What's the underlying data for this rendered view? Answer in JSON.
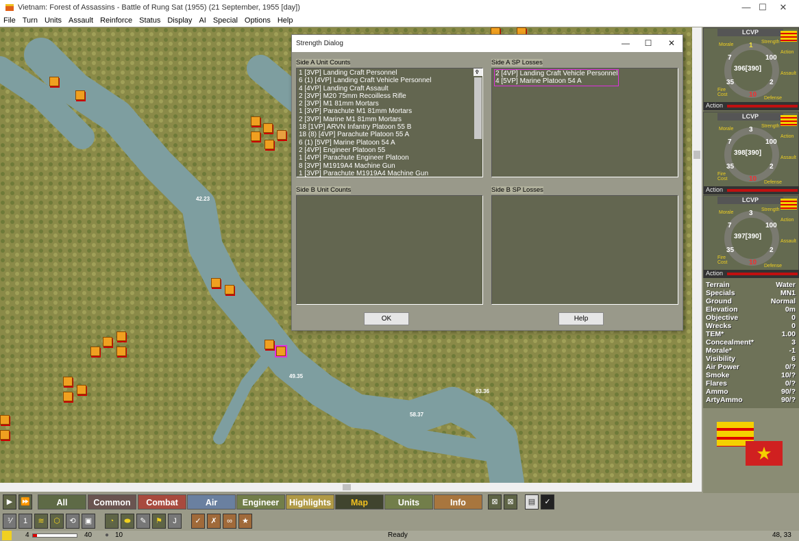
{
  "window": {
    "title": "Vietnam: Forest of Assassins - Battle of Rung Sat (1955) (21 September, 1955 [day])",
    "min": "—",
    "max": "☐",
    "close": "✕"
  },
  "menu": [
    "File",
    "Turn",
    "Units",
    "Assault",
    "Reinforce",
    "Status",
    "Display",
    "AI",
    "Special",
    "Options",
    "Help"
  ],
  "map": {
    "labels": [
      "42.23",
      "49.35",
      "58.37",
      "63.36"
    ],
    "colors": {
      "terrain": "#8e8c4a",
      "water": "#7e9ea0",
      "unit": "#f0a020"
    }
  },
  "dialog": {
    "title": "Strength Dialog",
    "sideA_counts_label": "Side A Unit Counts",
    "sideA_counts": [
      "1 [3VP] Landing Craft Personnel",
      "6 (1) [4VP] Landing Craft Vehicle Personnel",
      "4 [4VP] Landing Craft Assault",
      "2 [3VP] M20 75mm Recoilless Rifle",
      "2 [3VP] M1 81mm Mortars",
      "1 [3VP] Parachute M1 81mm Mortars",
      "2 [3VP] Marine M1 81mm Mortars",
      "18 [1VP] ARVN Infantry Platoon 55 B",
      "18 (8) [4VP] Parachute Platoon 55 A",
      "6 (1) [5VP] Marine Platoon 54 A",
      "2 [4VP] Engineer Platoon 55",
      "1 [4VP] Parachute Engineer Platoon",
      "8 [3VP] M1919A4 Machine Gun",
      "1 [3VP] Parachute M1919A4 Machine Gun"
    ],
    "sideA_losses_label": "Side A SP Losses",
    "sideA_losses": [
      "2 [4VP] Landing Craft Vehicle Personnel",
      "4 [5VP] Marine Platoon 54 A"
    ],
    "sideB_counts_label": "Side B Unit Counts",
    "sideB_losses_label": "Side B SP Losses",
    "ok": "OK",
    "help": "Help"
  },
  "cards": [
    {
      "name": "LCVP",
      "strength": "1",
      "morale": "7",
      "action": "100",
      "sp": "396[390]",
      "fire_cost": "35",
      "assault": "2",
      "defense": "10"
    },
    {
      "name": "LCVP",
      "strength": "3",
      "morale": "7",
      "action": "100",
      "sp": "398[390]",
      "fire_cost": "35",
      "assault": "2",
      "defense": "10"
    },
    {
      "name": "LCVP",
      "strength": "3",
      "morale": "7",
      "action": "100",
      "sp": "397[390]",
      "fire_cost": "35",
      "assault": "2",
      "defense": "10"
    }
  ],
  "card_labels": {
    "strength": "Strength",
    "morale": "Morale",
    "action": "Action",
    "assault": "Assault",
    "fire_cost": "Fire Cost",
    "defense": "Defense",
    "action_bar": "Action"
  },
  "info": [
    [
      "Terrain",
      "Water"
    ],
    [
      "Specials",
      "MN1"
    ],
    [
      "Ground",
      "Normal"
    ],
    [
      "Elevation",
      "0m"
    ],
    [
      "Objective",
      "0"
    ],
    [
      "Wrecks",
      "0"
    ],
    [
      "TEM*",
      "1.00"
    ],
    [
      "Concealment*",
      "3"
    ],
    [
      "Morale*",
      "-1"
    ],
    [
      "Visibility",
      "6"
    ],
    [
      "Air Power",
      "0/?"
    ],
    [
      "Smoke",
      "10/?"
    ],
    [
      "Flares",
      "0/?"
    ],
    [
      "Ammo",
      "90/?"
    ],
    [
      "ArtyAmmo",
      "90/?"
    ]
  ],
  "toolbar": {
    "tabs": [
      {
        "label": "All",
        "color": "#5e6a46"
      },
      {
        "label": "Common",
        "color": "#6a5450"
      },
      {
        "label": "Combat",
        "color": "#a84a3e"
      },
      {
        "label": "Air",
        "color": "#6a80a0"
      },
      {
        "label": "Engineer",
        "color": "#727e4a"
      },
      {
        "label": "Highlights",
        "color": "#b09a46"
      },
      {
        "label": "Map",
        "color": "#40442e"
      },
      {
        "label": "Units",
        "color": "#727e4a"
      },
      {
        "label": "Info",
        "color": "#a8763e"
      }
    ]
  },
  "status": {
    "turn": "4",
    "max_turn": "40",
    "turn_progress": 0.1,
    "weather_value": "10",
    "message": "Ready",
    "coords": "48, 33"
  }
}
